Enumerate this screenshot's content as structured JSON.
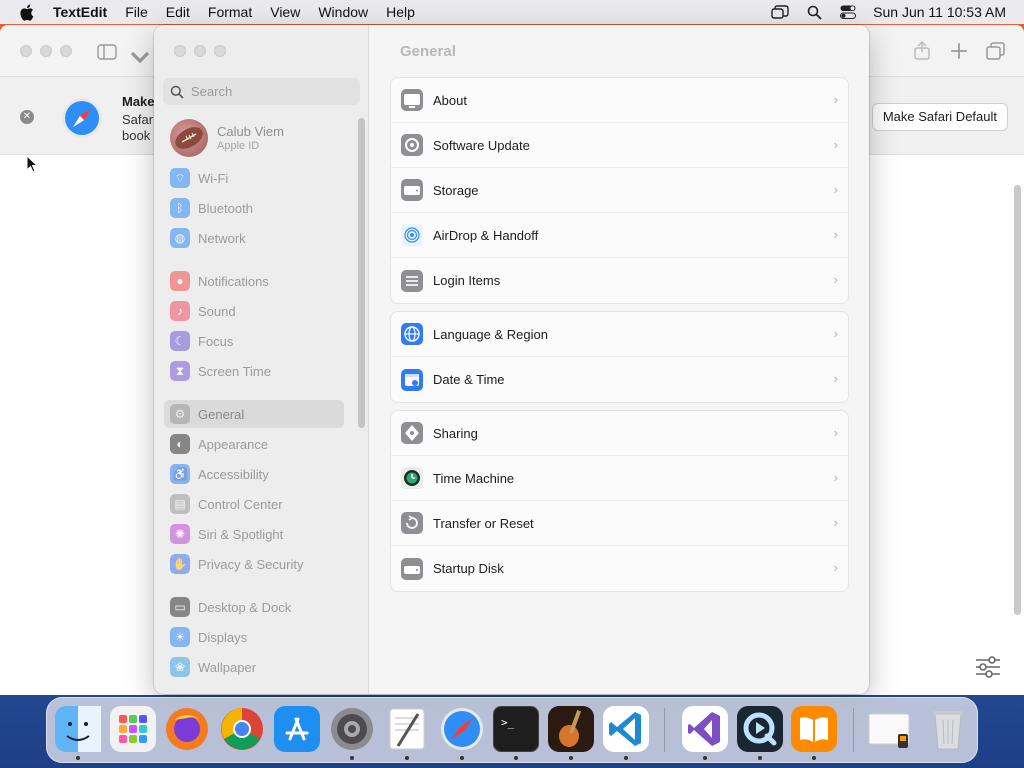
{
  "menubar": {
    "app_name": "TextEdit",
    "menus": [
      "File",
      "Edit",
      "Format",
      "View",
      "Window",
      "Help"
    ],
    "datetime": "Sun Jun 11  10:53 AM"
  },
  "background_window": {
    "banner_title": "Make",
    "banner_text_1": "Safar",
    "banner_text_2": "book",
    "default_button": "Make Safari Default"
  },
  "settings": {
    "search_placeholder": "Search",
    "profile": {
      "name": "Calub Viem",
      "subtitle": "Apple ID"
    },
    "sidebar": [
      {
        "label": "Wi-Fi",
        "icon": "wifi-icon",
        "color": "#2f8cf6"
      },
      {
        "label": "Bluetooth",
        "icon": "bluetooth-icon",
        "color": "#2f8cf6"
      },
      {
        "label": "Network",
        "icon": "network-icon",
        "color": "#2f8cf6"
      },
      {
        "label": "Notifications",
        "icon": "notifications-icon",
        "color": "#f05050"
      },
      {
        "label": "Sound",
        "icon": "sound-icon",
        "color": "#f0506a"
      },
      {
        "label": "Focus",
        "icon": "focus-icon",
        "color": "#6e5ad6"
      },
      {
        "label": "Screen Time",
        "icon": "screen-time-icon",
        "color": "#7a5ad6"
      },
      {
        "label": "General",
        "icon": "gear-icon",
        "color": "#9a9a9a",
        "selected": true
      },
      {
        "label": "Appearance",
        "icon": "appearance-icon",
        "color": "#333333"
      },
      {
        "label": "Accessibility",
        "icon": "accessibility-icon",
        "color": "#2f8cf6"
      },
      {
        "label": "Control Center",
        "icon": "control-center-icon",
        "color": "#9a9a9a"
      },
      {
        "label": "Siri & Spotlight",
        "icon": "siri-icon",
        "color": "#c04ad0"
      },
      {
        "label": "Privacy & Security",
        "icon": "privacy-icon",
        "color": "#3c78f0"
      },
      {
        "label": "Desktop & Dock",
        "icon": "desktop-dock-icon",
        "color": "#333333"
      },
      {
        "label": "Displays",
        "icon": "displays-icon",
        "color": "#2f8cf6"
      },
      {
        "label": "Wallpaper",
        "icon": "wallpaper-icon",
        "color": "#3aa7e8"
      }
    ],
    "content_title": "General",
    "groups": [
      [
        {
          "label": "About",
          "icon": "about-icon"
        },
        {
          "label": "Software Update",
          "icon": "software-update-icon"
        },
        {
          "label": "Storage",
          "icon": "storage-icon"
        },
        {
          "label": "AirDrop & Handoff",
          "icon": "airdrop-icon"
        },
        {
          "label": "Login Items",
          "icon": "login-items-icon"
        }
      ],
      [
        {
          "label": "Language & Region",
          "icon": "language-icon"
        },
        {
          "label": "Date & Time",
          "icon": "date-time-icon"
        }
      ],
      [
        {
          "label": "Sharing",
          "icon": "sharing-icon"
        },
        {
          "label": "Time Machine",
          "icon": "time-machine-icon"
        },
        {
          "label": "Transfer or Reset",
          "icon": "transfer-reset-icon"
        },
        {
          "label": "Startup Disk",
          "icon": "startup-disk-icon"
        }
      ]
    ]
  },
  "dock": [
    {
      "name": "Finder",
      "icon": "finder-icon",
      "running": true
    },
    {
      "name": "Launchpad",
      "icon": "launchpad-icon",
      "running": false
    },
    {
      "name": "Firefox",
      "icon": "firefox-icon",
      "running": false
    },
    {
      "name": "Chrome",
      "icon": "chrome-icon",
      "running": false
    },
    {
      "name": "App Store",
      "icon": "app-store-icon",
      "running": false
    },
    {
      "name": "System Settings",
      "icon": "system-settings-icon",
      "running": true
    },
    {
      "name": "TextEdit",
      "icon": "textedit-icon",
      "running": true
    },
    {
      "name": "Safari",
      "icon": "safari-icon",
      "running": true
    },
    {
      "name": "Terminal",
      "icon": "terminal-icon",
      "running": true
    },
    {
      "name": "GarageBand",
      "icon": "garageband-icon",
      "running": true
    },
    {
      "name": "VS Code",
      "icon": "vscode-icon",
      "running": true
    },
    {
      "name": "Visual Studio",
      "icon": "visual-studio-icon",
      "running": true
    },
    {
      "name": "QuickTime",
      "icon": "quicktime-icon",
      "running": true
    },
    {
      "name": "Books",
      "icon": "books-icon",
      "running": true
    },
    {
      "name": "Preview",
      "icon": "preview-icon",
      "running": false
    },
    {
      "name": "Trash",
      "icon": "trash-icon",
      "running": false
    }
  ]
}
